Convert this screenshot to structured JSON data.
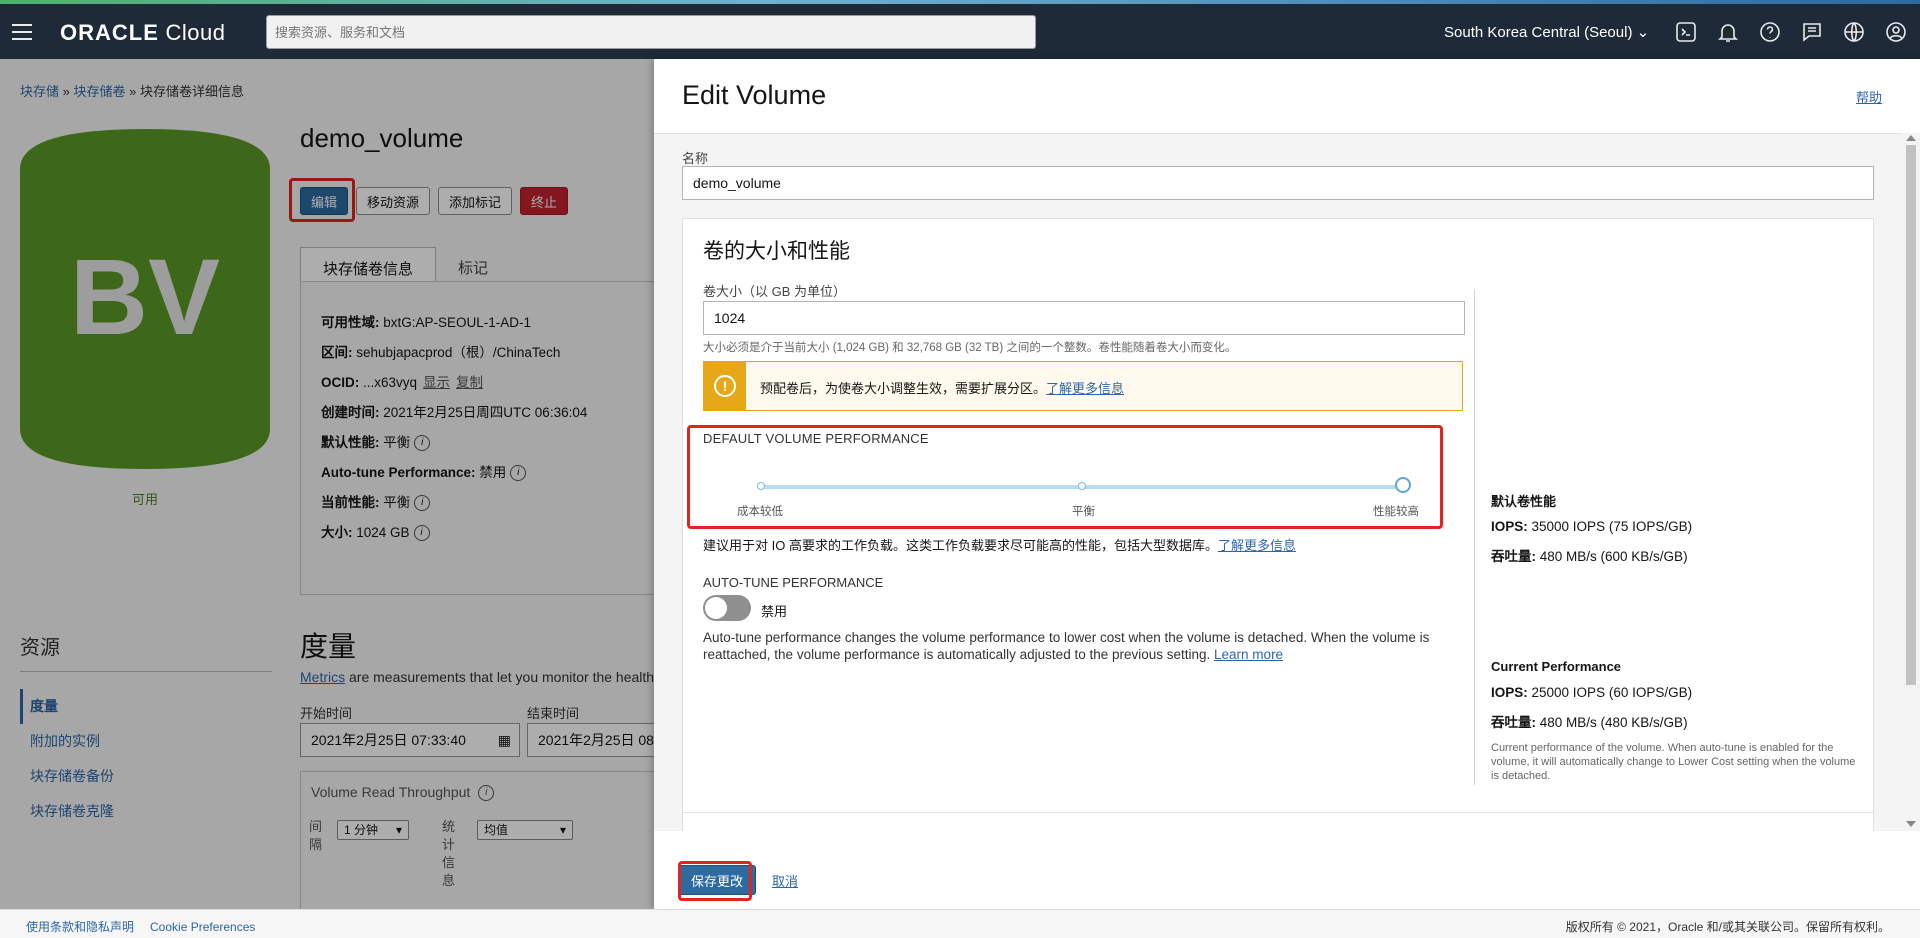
{
  "topbar": {
    "brand_bold": "ORACLE",
    "brand_light": " Cloud",
    "search_placeholder": "搜索资源、服务和文档",
    "region": "South Korea Central (Seoul)"
  },
  "breadcrumb": {
    "item1": "块存储",
    "sep": " » ",
    "item2": "块存储卷",
    "item3": "块存储卷详细信息"
  },
  "volume": {
    "icon_text": "BV",
    "state": "可用",
    "name": "demo_volume"
  },
  "actions": {
    "edit": "编辑",
    "move": "移动资源",
    "add_tags": "添加标记",
    "terminate": "终止"
  },
  "tabs": {
    "info": "块存储卷信息",
    "tags": "标记"
  },
  "info": {
    "ad_label": "可用性域:",
    "ad_value": " bxtG:AP-SEOUL-1-AD-1",
    "compartment_label": "区间:",
    "compartment_value": " sehubjapacprod（根）/ChinaTech",
    "ocid_label": "OCID:",
    "ocid_value": " ...x63vyq",
    "ocid_show": "显示",
    "ocid_copy": "复制",
    "created_label": "创建时间:",
    "created_value": " 2021年2月25日周四UTC 06:36:04",
    "default_perf_label": "默认性能:",
    "default_perf_value": " 平衡",
    "autotune_label": "Auto-tune Performance:",
    "autotune_value": " 禁用",
    "current_perf_label": "当前性能:",
    "current_perf_value": " 平衡",
    "size_label": "大小:",
    "size_value": " 1024 GB"
  },
  "resources": {
    "heading": "资源",
    "items": [
      "度量",
      "附加的实例",
      "块存储卷备份",
      "块存储卷克隆"
    ]
  },
  "metrics": {
    "heading": "度量",
    "desc_link": "Metrics",
    "desc_rest": " are measurements that let you monitor the health",
    "start_label": "开始时间",
    "start_value": "2021年2月25日 07:33:40",
    "end_label": "结束时间",
    "end_value": "2021年2月25日 08",
    "chart_title": "Volume Read Throughput",
    "interval_label": "间隔",
    "interval_value": "1 分钟",
    "stat_label": "统计信息",
    "stat_value": "均值"
  },
  "footer": {
    "terms": "使用条款和隐私声明",
    "cookie": "Cookie Preferences",
    "copyright": "版权所有 © 2021，Oracle 和/或其关联公司。保留所有权利。"
  },
  "drawer": {
    "title": "Edit Volume",
    "help": "帮助",
    "name_label": "名称",
    "name_value": "demo_volume",
    "section_title": "卷的大小和性能",
    "size_label": "卷大小（以 GB 为单位）",
    "size_value": "1024",
    "size_hint": "大小必须是介于当前大小 (1,024 GB) 和 32,768 GB (32 TB) 之间的一个整数。卷性能随着卷大小而变化。",
    "warn_icon": "!",
    "warn_text": "预配卷后，为使卷大小调整生效，需要扩展分区。",
    "warn_link": "了解更多信息",
    "perf_heading": "DEFAULT VOLUME PERFORMANCE",
    "slider_low": "成本较低",
    "slider_mid": "平衡",
    "slider_high": "性能较高",
    "slider_selected": "性能较高",
    "perf_desc": "建议用于对 IO 高要求的工作负载。这类工作负载要求尽可能高的性能，包括大型数据库。",
    "perf_link": "了解更多信息",
    "autotune_heading": "AUTO-TUNE PERFORMANCE",
    "autotune_toggle": "禁用",
    "autotune_desc": "Auto-tune performance changes the volume performance to lower cost when the volume is detached. When the volume is reattached, the volume performance is automatically adjusted to the previous setting. ",
    "autotune_link": "Learn more",
    "default_heading": "默认卷性能",
    "default_iops_label": "IOPS:",
    "default_iops_value": " 35000 IOPS (75 IOPS/GB)",
    "default_tp_label": "吞吐量:",
    "default_tp_value": " 480 MB/s (600 KB/s/GB)",
    "current_heading": "Current Performance",
    "current_iops_label": "IOPS:",
    "current_iops_value": " 25000 IOPS (60 IOPS/GB)",
    "current_tp_label": "吞吐量:",
    "current_tp_value": " 480 MB/s (480 KB/s/GB)",
    "current_note": "Current performance of the volume. When auto-tune is enabled for the volume, it will automatically change to Lower Cost setting when the volume is detached.",
    "save": "保存更改",
    "cancel": "取消"
  },
  "colors": {
    "nav": "#1e2a38",
    "primary": "#2c6aa0",
    "danger": "#c4202e",
    "bv_green": "#5a9a26",
    "highlight": "#e0251e",
    "warning": "#e6a817"
  }
}
